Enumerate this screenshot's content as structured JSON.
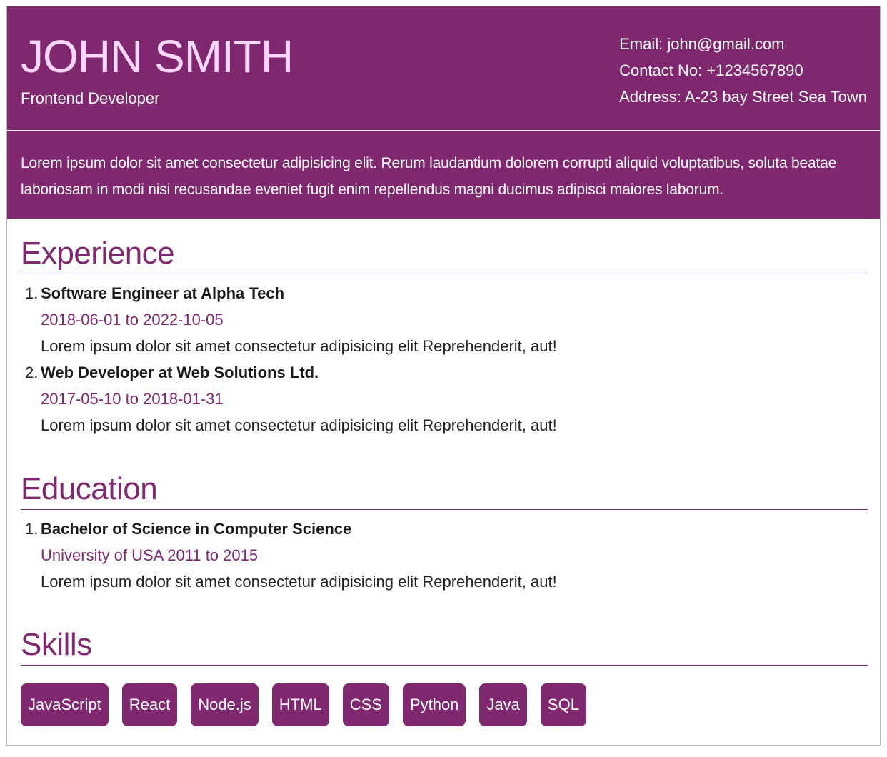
{
  "header": {
    "name": "JOHN SMITH",
    "title": "Frontend Developer",
    "contact": [
      "Email: john@gmail.com",
      "Contact No: +1234567890",
      "Address: A-23 bay Street Sea Town"
    ]
  },
  "summary": "Lorem ipsum dolor sit amet consectetur adipisicing elit. Rerum laudantium dolorem corrupti aliquid voluptatibus, soluta beatae laboriosam in modi nisi recusandae eveniet fugit enim repellendus magni ducimus adipisci maiores laborum.",
  "experience": {
    "heading": "Experience",
    "items": [
      {
        "number": "1.",
        "title": "Software Engineer at Alpha Tech",
        "dates": "2018-06-01 to 2022-10-05",
        "description": "Lorem ipsum dolor sit amet consectetur adipisicing elit Reprehenderit, aut!"
      },
      {
        "number": "2.",
        "title": "Web Developer at Web Solutions Ltd.",
        "dates": "2017-05-10 to 2018-01-31",
        "description": "Lorem ipsum dolor sit amet consectetur adipisicing elit Reprehenderit, aut!"
      }
    ]
  },
  "education": {
    "heading": "Education",
    "items": [
      {
        "number": "1.",
        "title": "Bachelor of Science in Computer Science",
        "dates": "University of USA 2011 to 2015",
        "description": "Lorem ipsum dolor sit amet consectetur adipisicing elit Reprehenderit, aut!"
      }
    ]
  },
  "skills": {
    "heading": "Skills",
    "items": [
      "JavaScript",
      "React",
      "Node.js",
      "HTML",
      "CSS",
      "Python",
      "Java",
      "SQL"
    ]
  },
  "colors": {
    "accent": "#7f2870",
    "name": "#fbd6fb",
    "text": "#222222"
  }
}
